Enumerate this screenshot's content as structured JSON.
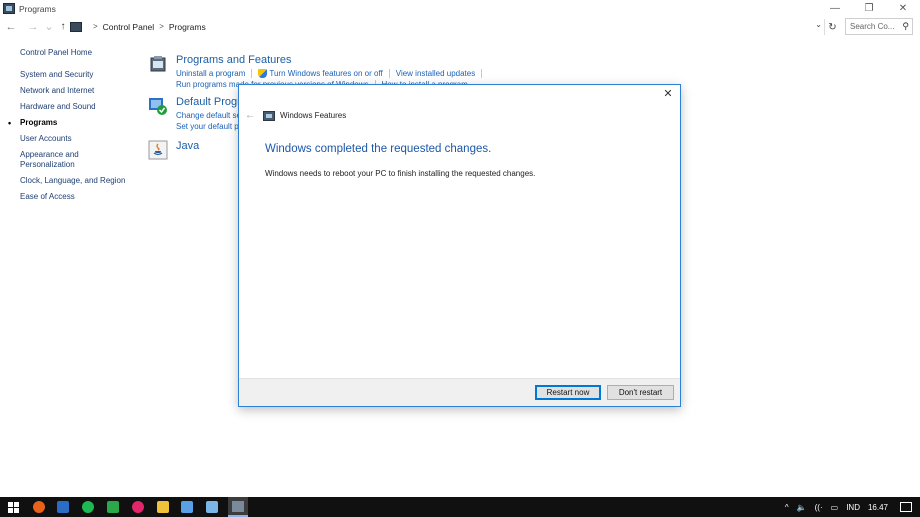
{
  "window": {
    "title": "Programs",
    "minimize": "—",
    "restore": "❐",
    "close": "✕"
  },
  "address": {
    "back": "←",
    "forward": "→",
    "recent": "⌄",
    "up": "↑",
    "sep1": ">",
    "crumb1": "Control Panel",
    "sep2": ">",
    "crumb2": "Programs",
    "dropdown": "⌄",
    "refresh": "↻",
    "search_placeholder": "Search Co...",
    "search_icon": "⚲"
  },
  "leftnav": {
    "items": [
      {
        "label": "Control Panel Home"
      },
      {
        "label": "System and Security"
      },
      {
        "label": "Network and Internet"
      },
      {
        "label": "Hardware and Sound"
      },
      {
        "label": "Programs"
      },
      {
        "label": "User Accounts"
      },
      {
        "label": "Appearance and Personalization"
      },
      {
        "label": "Clock, Language, and Region"
      },
      {
        "label": "Ease of Access"
      }
    ]
  },
  "categories": {
    "programs_features": {
      "title": "Programs and Features",
      "link1": "Uninstall a program",
      "link2": "Turn Windows features on or off",
      "link3": "View installed updates",
      "link4": "Run programs made for previous versions of Windows",
      "link5": "How to install a program"
    },
    "default_programs": {
      "title": "Default Programs",
      "link1": "Change default settings for media or devices",
      "link2": "Set your default programs"
    },
    "java": {
      "title": "Java"
    }
  },
  "dialog": {
    "close": "✕",
    "back": "←",
    "title": "Windows Features",
    "heading": "Windows completed the requested changes.",
    "message": "Windows needs to reboot your PC to finish installing the requested changes.",
    "restart_label": "Restart now",
    "dont_restart_label": "Don't restart"
  },
  "taskbar": {
    "tray_chevron": "^",
    "volume": "🔈",
    "wifi": "((·",
    "battery": "▭",
    "language": "IND",
    "time": "16.47"
  },
  "colors": {
    "accent": "#2e7fd6",
    "link": "#1a62b8",
    "heading": "#1c57a8",
    "taskbar": "#101010"
  }
}
